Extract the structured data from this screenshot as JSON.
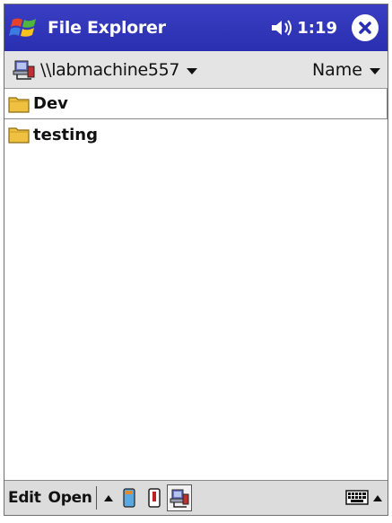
{
  "titlebar": {
    "app_title": "File Explorer",
    "clock": "1:19",
    "icons": {
      "start": "windows-flag-icon",
      "volume": "speaker-icon",
      "close": "close-icon"
    }
  },
  "pathbar": {
    "path": "\\\\labmachine557",
    "sort_label": "Name",
    "icons": {
      "network": "network-share-icon",
      "dropdown": "chevron-down-icon"
    }
  },
  "files": [
    {
      "name": "Dev",
      "type": "folder",
      "selected": true
    },
    {
      "name": "testing",
      "type": "folder",
      "selected": false
    }
  ],
  "cmdbar": {
    "edit_label": "Edit",
    "open_label": "Open",
    "icons": [
      "up-arrow-icon",
      "storage-card-icon",
      "pda-icon",
      "network-icon",
      "keyboard-icon",
      "up-arrow-icon"
    ]
  },
  "colors": {
    "titlebar": "#3a3ec2",
    "folder": "#f0c040"
  }
}
